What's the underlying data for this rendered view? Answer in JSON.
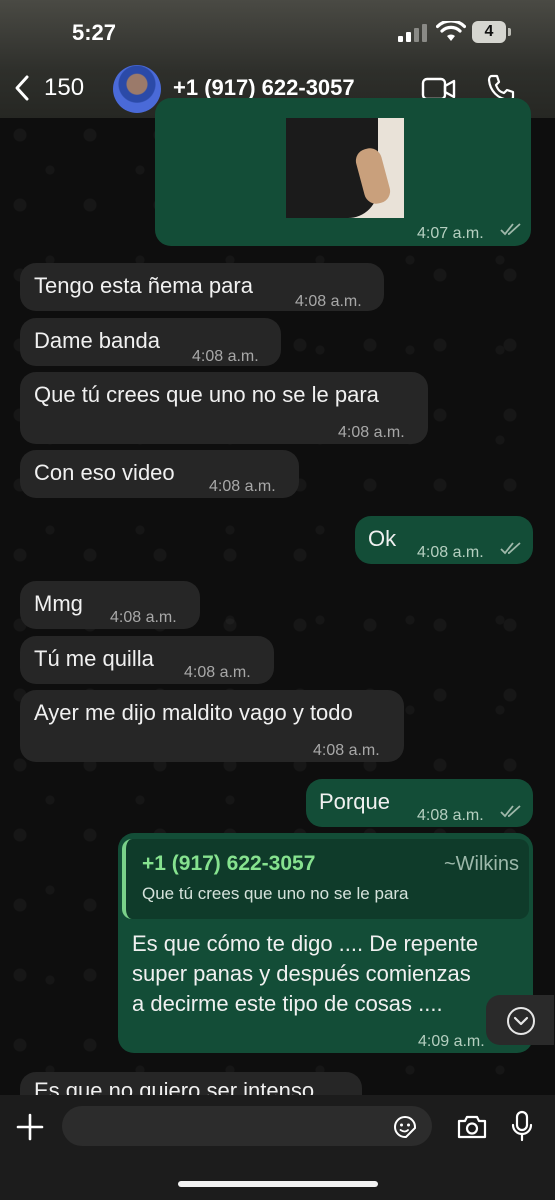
{
  "status": {
    "time": "5:27",
    "battery": "4"
  },
  "header": {
    "back_count": "150",
    "contact": "+1 (917) 622-3057"
  },
  "messages": [
    {
      "dir": "out",
      "type": "image",
      "time": "4:07 a.m."
    },
    {
      "dir": "in",
      "text": "Tengo esta ñema para",
      "time": "4:08 a.m."
    },
    {
      "dir": "in",
      "text": "Dame banda",
      "time": "4:08 a.m."
    },
    {
      "dir": "in",
      "text": "Que tú crees que uno no se le para",
      "time": "4:08 a.m."
    },
    {
      "dir": "in",
      "text": "Con eso video",
      "time": "4:08 a.m."
    },
    {
      "dir": "out",
      "text": "Ok",
      "time": "4:08 a.m."
    },
    {
      "dir": "in",
      "text": "Mmg",
      "time": "4:08 a.m."
    },
    {
      "dir": "in",
      "text": "Tú me quilla",
      "time": "4:08 a.m."
    },
    {
      "dir": "in",
      "text": "Ayer me dijo maldito vago y todo",
      "time": "4:08 a.m."
    },
    {
      "dir": "out",
      "text": "Porque",
      "time": "4:08 a.m."
    },
    {
      "dir": "out",
      "reply": {
        "name": "+1 (917) 622-3057",
        "alias": "~Wilkins",
        "quoted": "Que tú crees que uno no se le para"
      },
      "lines": [
        "Es que cómo te digo .... De repente",
        "super panas y después comienzas",
        "a decirme este tipo de cosas ...."
      ],
      "time": "4:09 a.m."
    },
    {
      "dir": "in",
      "text": "Es que no quiero ser intenso",
      "partial": true
    }
  ],
  "composer": {
    "placeholder": ""
  },
  "icons": [
    "back-chevron-icon",
    "video-call-icon",
    "phone-call-icon",
    "plus-icon",
    "sticker-icon",
    "camera-icon",
    "microphone-icon",
    "chevron-down-icon",
    "read-ticks-icon"
  ]
}
